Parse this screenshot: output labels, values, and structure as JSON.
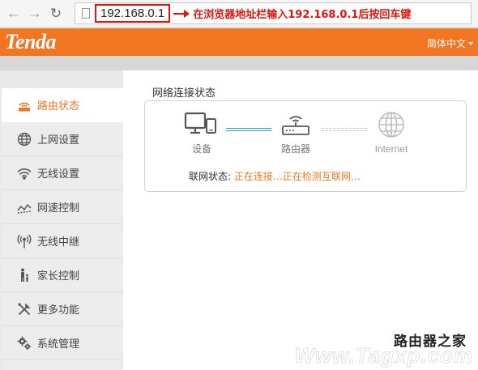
{
  "browser": {
    "url": "192.168.0.1",
    "annotation": "在浏览器地址栏输入192.168.0.1后按回车键"
  },
  "header": {
    "logo": "Tenda",
    "language": "简体中文"
  },
  "sidebar": {
    "items": [
      {
        "label": "路由状态",
        "icon": "router-status-icon",
        "active": true
      },
      {
        "label": "上网设置",
        "icon": "globe-icon",
        "active": false
      },
      {
        "label": "无线设置",
        "icon": "wifi-icon",
        "active": false
      },
      {
        "label": "网速控制",
        "icon": "speed-line-icon",
        "active": false
      },
      {
        "label": "无线中继",
        "icon": "antenna-icon",
        "active": false
      },
      {
        "label": "家长控制",
        "icon": "parent-child-icon",
        "active": false
      },
      {
        "label": "更多功能",
        "icon": "tools-icon",
        "active": false
      },
      {
        "label": "系统管理",
        "icon": "gears-icon",
        "active": false
      }
    ]
  },
  "main": {
    "section_title": "网络连接状态",
    "nodes": {
      "device": "设备",
      "router": "路由器",
      "internet": "Internet"
    },
    "status_label": "联网状态:",
    "status_value": "正在连接…正在检测互联网…"
  },
  "watermark": {
    "line1": "路由器之家",
    "line2": "Www.Tagxp.com"
  },
  "colors": {
    "brand": "#f27622",
    "link_active": "#29a3d6",
    "annotation": "#e0140a"
  }
}
